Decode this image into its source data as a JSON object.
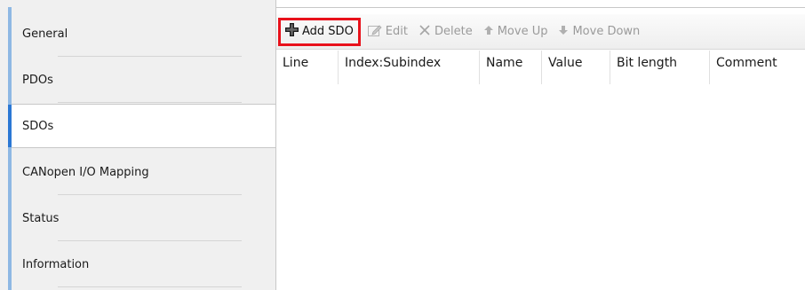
{
  "sidebar": {
    "items": [
      {
        "label": "General",
        "selected": false
      },
      {
        "label": "PDOs",
        "selected": false
      },
      {
        "label": "SDOs",
        "selected": true
      },
      {
        "label": "CANopen I/O Mapping",
        "selected": false
      },
      {
        "label": "Status",
        "selected": false
      },
      {
        "label": "Information",
        "selected": false
      }
    ]
  },
  "toolbar": {
    "add_label": "Add SDO",
    "edit_label": "Edit",
    "delete_label": "Delete",
    "move_up_label": "Move Up",
    "move_down_label": "Move Down",
    "icons": {
      "add": "plus-icon",
      "edit": "pencil-icon",
      "delete": "x-icon",
      "move_up": "arrow-up-icon",
      "move_down": "arrow-down-icon"
    },
    "highlight_color": "#e8111b"
  },
  "table": {
    "columns": [
      "Line",
      "Index:Subindex",
      "Name",
      "Value",
      "Bit length",
      "Comment"
    ],
    "rows": []
  },
  "colors": {
    "selected_accent": "#2b78d4",
    "sidebar_bg": "#f0f0f0"
  }
}
